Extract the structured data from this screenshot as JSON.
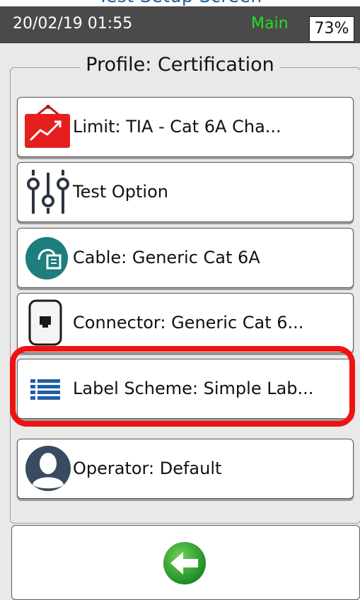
{
  "window": {
    "clipped_title": "Test Setup Screen"
  },
  "status_bar": {
    "datetime": "20/02/19 01:55",
    "mode": "Main",
    "battery": "73%"
  },
  "profile": {
    "title": "Profile: Certification",
    "items": [
      {
        "label": "Limit: TIA - Cat 6A Cha...",
        "icon": "limit-chart-icon"
      },
      {
        "label": "Test Option",
        "icon": "sliders-icon"
      },
      {
        "label": "Cable: Generic Cat 6A",
        "icon": "cable-icon"
      },
      {
        "label": "Connector: Generic Cat 6...",
        "icon": "connector-icon"
      },
      {
        "label": "Label Scheme: Simple Lab...",
        "icon": "label-list-icon",
        "highlighted": true
      },
      {
        "label": "Operator: Default",
        "icon": "user-icon"
      }
    ]
  },
  "footer": {
    "back_icon": "back-arrow-icon"
  },
  "colors": {
    "highlight": "#ee1212",
    "mode_text": "#22e022",
    "status_bar": "#4a4a4a"
  }
}
